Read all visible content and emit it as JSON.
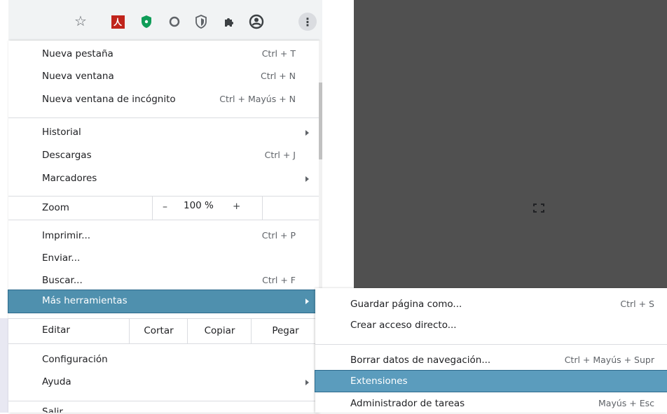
{
  "toolbar": {
    "icons": [
      "star-icon",
      "pdf-extension-icon",
      "shield-extension-icon",
      "ring-extension-icon",
      "privacy-extension-icon",
      "extensions-puzzle-icon",
      "account-icon",
      "kebab-menu-icon"
    ],
    "pdf_glyph": "人",
    "kebab_glyph": "⋮"
  },
  "menu": {
    "new_tab": {
      "label": "Nueva pestaña",
      "shortcut": "Ctrl + T"
    },
    "new_window": {
      "label": "Nueva ventana",
      "shortcut": "Ctrl + N"
    },
    "incognito": {
      "label": "Nueva ventana de incógnito",
      "shortcut": "Ctrl + Mayús + N"
    },
    "history": {
      "label": "Historial"
    },
    "downloads": {
      "label": "Descargas",
      "shortcut": "Ctrl + J"
    },
    "bookmarks": {
      "label": "Marcadores"
    },
    "zoom": {
      "label": "Zoom",
      "minus": "–",
      "value": "100 %",
      "plus": "+"
    },
    "print": {
      "label": "Imprimir...",
      "shortcut": "Ctrl + P"
    },
    "cast": {
      "label": "Enviar..."
    },
    "find": {
      "label": "Buscar...",
      "shortcut": "Ctrl + F"
    },
    "more_tools": {
      "label": "Más herramientas"
    },
    "edit": {
      "label": "Editar",
      "cut": "Cortar",
      "copy": "Copiar",
      "paste": "Pegar"
    },
    "settings": {
      "label": "Configuración"
    },
    "help": {
      "label": "Ayuda"
    },
    "exit": {
      "label": "Salir"
    }
  },
  "submenu": {
    "save_page": {
      "label": "Guardar página como...",
      "shortcut": "Ctrl + S"
    },
    "create_shortcut": {
      "label": "Crear acceso directo..."
    },
    "clear_data": {
      "label": "Borrar datos de navegación...",
      "shortcut": "Ctrl + Mayús + Supr"
    },
    "extensions": {
      "label": "Extensiones"
    },
    "task_manager": {
      "label": "Administrador de tareas",
      "shortcut": "Mayús + Esc"
    }
  },
  "colors": {
    "highlight": "#4f90ae",
    "dark_panel": "#505050",
    "toolbar": "#f1f3f4"
  }
}
